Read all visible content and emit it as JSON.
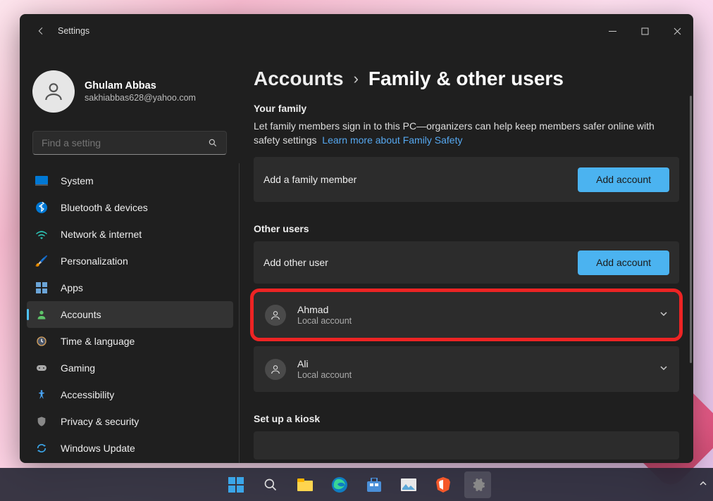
{
  "window": {
    "title": "Settings"
  },
  "profile": {
    "name": "Ghulam Abbas",
    "email": "sakhiabbas628@yahoo.com"
  },
  "search": {
    "placeholder": "Find a setting"
  },
  "nav": {
    "items": [
      {
        "label": "System",
        "icon": "🖥️"
      },
      {
        "label": "Bluetooth & devices",
        "icon": "bt"
      },
      {
        "label": "Network & internet",
        "icon": "wifi"
      },
      {
        "label": "Personalization",
        "icon": "🖌️"
      },
      {
        "label": "Apps",
        "icon": "apps"
      },
      {
        "label": "Accounts",
        "icon": "👤",
        "active": true
      },
      {
        "label": "Time & language",
        "icon": "🕒"
      },
      {
        "label": "Gaming",
        "icon": "🎮"
      },
      {
        "label": "Accessibility",
        "icon": "acc"
      },
      {
        "label": "Privacy & security",
        "icon": "🛡️"
      },
      {
        "label": "Windows Update",
        "icon": "🔄"
      }
    ]
  },
  "breadcrumb": {
    "parent": "Accounts",
    "current": "Family & other users"
  },
  "family": {
    "title": "Your family",
    "desc": "Let family members sign in to this PC—organizers can help keep members safer online with safety settings",
    "link": "Learn more about Family Safety",
    "add_label": "Add a family member",
    "add_btn": "Add account"
  },
  "other": {
    "title": "Other users",
    "add_label": "Add other user",
    "add_btn": "Add account",
    "users": [
      {
        "name": "Ahmad",
        "type": "Local account",
        "highlighted": true
      },
      {
        "name": "Ali",
        "type": "Local account"
      }
    ]
  },
  "kiosk": {
    "title": "Set up a kiosk"
  }
}
